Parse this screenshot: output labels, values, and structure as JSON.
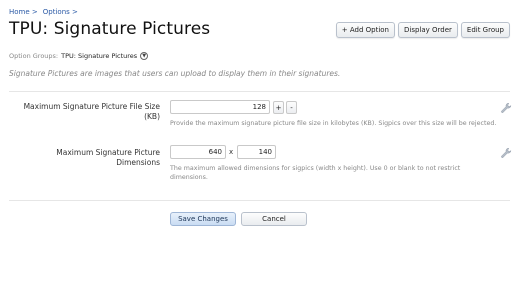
{
  "breadcrumb": [
    {
      "label": "Home >"
    },
    {
      "label": "Options >"
    }
  ],
  "page_title": "TPU: Signature Pictures",
  "toolbar": {
    "add_option": "+ Add Option",
    "display_order": "Display Order",
    "edit_group": "Edit Group"
  },
  "option_groups": {
    "label": "Option Groups:",
    "value": "TPU: Signature Pictures"
  },
  "description": "Signature Pictures are images that users can upload to display them in their signatures.",
  "options": [
    {
      "label": "Maximum Signature Picture File Size (KB)",
      "value": "128",
      "plus": "+",
      "minus": "-",
      "help": "Provide the maximum signature picture file size in kilobytes (KB). Sigpics over this size will be rejected."
    },
    {
      "label": "Maximum Signature Picture Dimensions",
      "width": "640",
      "x": "x",
      "height": "140",
      "help": "The maximum allowed dimensions for sigpics (width x height). Use 0 or blank to not restrict dimensions."
    }
  ],
  "buttons": {
    "save": "Save Changes",
    "cancel": "Cancel"
  },
  "icons": {
    "option_group_dropdown": "chevron-down-icon",
    "edit_option": "wrench-icon"
  },
  "colors": {
    "link": "#2b5aa6",
    "muted_text": "#888888",
    "primary_button": "#c9dcf3"
  }
}
